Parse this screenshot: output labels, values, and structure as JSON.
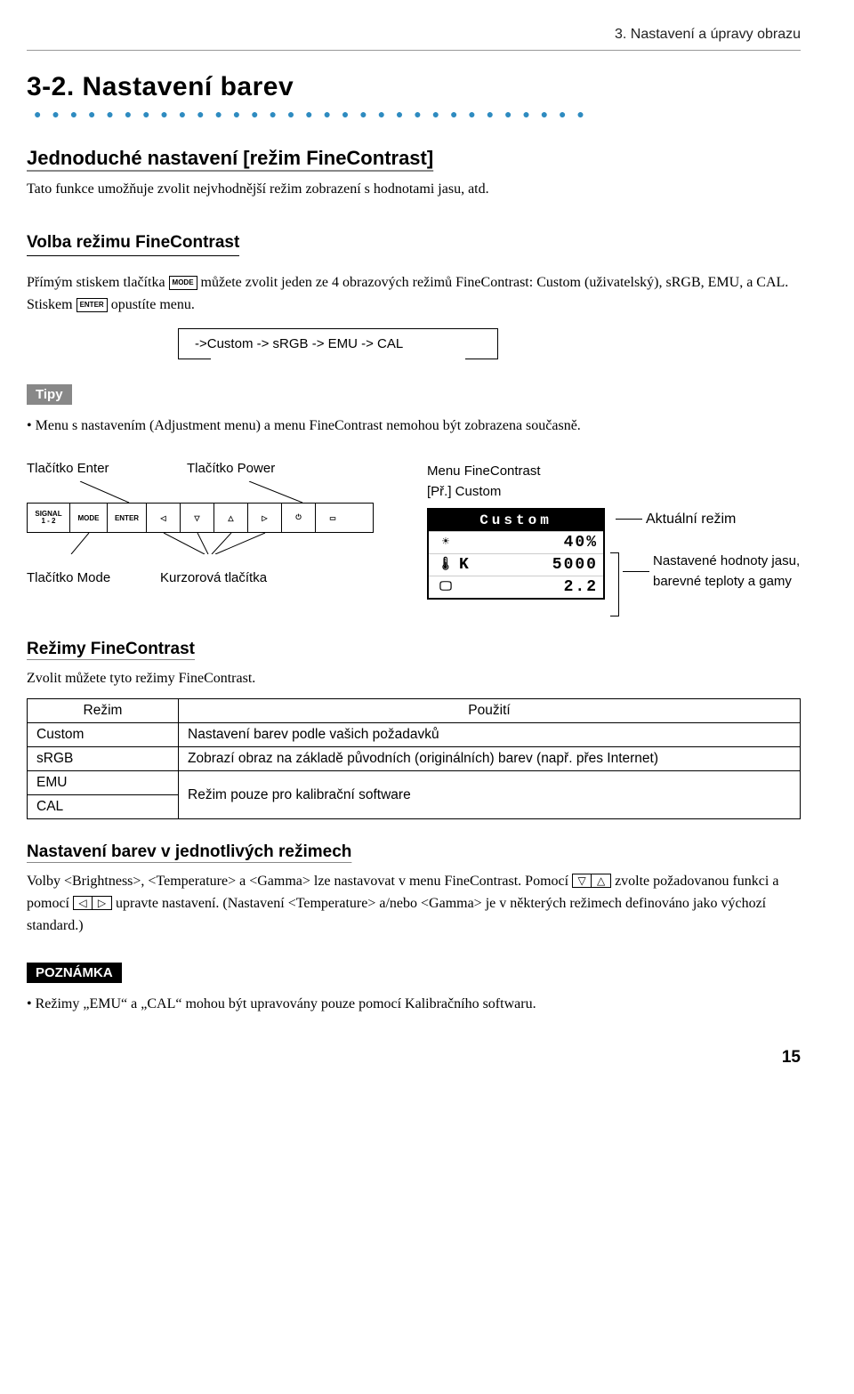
{
  "breadcrumb": "3. Nastavení a úpravy obrazu",
  "h1": "3-2. Nastavení barev",
  "h2_simple": "Jednoduché nastavení [režim FineContrast]",
  "p_intro": "Tato funkce umožňuje zvolit nejvhodnější režim zobrazení s hodnotami jasu, atd.",
  "h3_volba": "Volba režimu FineContrast",
  "p_volba_a": "Přímým stiskem tlačítka ",
  "key_mode": "MODE",
  "p_volba_b": " můžete zvolit jeden ze 4 obrazových režimů FineContrast: Custom (uživatelský), sRGB, EMU, a CAL. Stiskem ",
  "key_enter": "ENTER",
  "p_volba_c": " opustíte menu.",
  "cycle": "->Custom -> sRGB -> EMU -> CAL",
  "tag_tipy": "Tipy",
  "bullet_tipy": "Menu s nastavením (Adjustment menu) a menu FineContrast nemohou být zobrazena současně.",
  "diagram": {
    "enter_label": "Tlačítko Enter",
    "power_label": "Tlačítko Power",
    "mode_label": "Tlačítko Mode",
    "cursor_label": "Kurzorová tlačítka",
    "strip": {
      "signal_top": "SIGNAL",
      "signal_bot": "1 - 2",
      "mode": "MODE",
      "enter": "ENTER",
      "left": "◁",
      "down": "▽",
      "up": "△",
      "right": "▷",
      "power": "⏻",
      "led": "▭"
    }
  },
  "osd": {
    "menu_caption_a": "Menu FineContrast",
    "menu_caption_b": "[Př.] Custom",
    "title": "Custom",
    "rows": [
      {
        "icon": "☀",
        "k": "",
        "val": "40%"
      },
      {
        "icon": "🌡",
        "k": "K",
        "val": "5000"
      },
      {
        "icon": "🖵",
        "k": "",
        "val": "2.2"
      }
    ],
    "annot_mode": "Aktuální režim",
    "annot_vals_a": "Nastavené hodnoty jasu,",
    "annot_vals_b": "barevné teploty a gamy"
  },
  "h3_modes": "Režimy FineContrast",
  "p_modes_intro": "Zvolit můžete tyto režimy FineContrast.",
  "modes_table": {
    "th_mode": "Režim",
    "th_use": "Použití",
    "rows": [
      {
        "mode": "Custom",
        "use": "Nastavení barev podle vašich požadavků"
      },
      {
        "mode": "sRGB",
        "use": "Zobrazí obraz na základě původních (originálních) barev (např. přes Internet)"
      },
      {
        "mode": "EMU",
        "use": "Režim pouze pro kalibrační software"
      },
      {
        "mode": "CAL",
        "use": ""
      }
    ]
  },
  "h4_adjust": "Nastavení barev v jednotlivých režimech",
  "p_adjust_a": "Volby <Brightness>, <Temperature> a <Gamma> lze nastavovat v menu  FineContrast. Pomocí ",
  "p_adjust_b": " zvolte požadovanou funkci a pomocí ",
  "p_adjust_c": " upravte nastavení. (Nastavení <Temperature> a/nebo <Gamma> je v některých režimech definováno jako výchozí standard.)",
  "arr": {
    "down": "▽",
    "up": "△",
    "left": "◁",
    "right": "▷"
  },
  "tag_note": "POZNÁMKA",
  "bullet_note": "Režimy „EMU“ a „CAL“ mohou být upravovány pouze pomocí Kalibračního softwaru.",
  "page_num": "15"
}
